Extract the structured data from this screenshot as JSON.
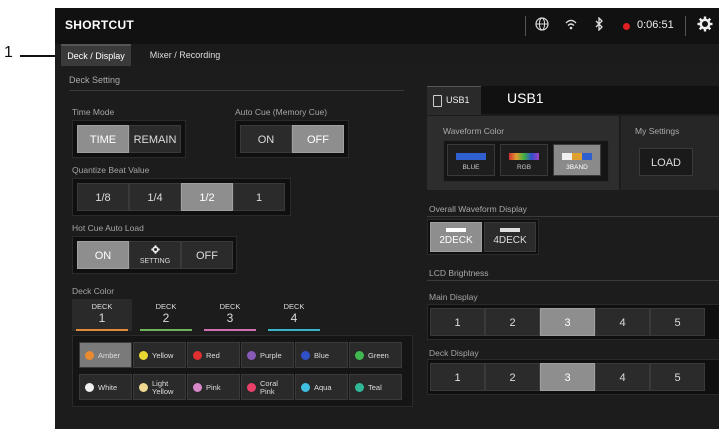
{
  "callout": "1",
  "app": {
    "title": "SHORTCUT",
    "rec_time": "0:06:51"
  },
  "tabs": [
    {
      "label": "Deck / Display"
    },
    {
      "label": "Mixer / Recording"
    }
  ],
  "deck_setting": {
    "title": "Deck Setting",
    "time_mode": {
      "label": "Time Mode",
      "options": [
        "TIME",
        "REMAIN"
      ],
      "selected": "TIME"
    },
    "auto_cue": {
      "label": "Auto Cue (Memory Cue)",
      "options": [
        "ON",
        "OFF"
      ],
      "selected": "OFF"
    },
    "quantize": {
      "label": "Quantize Beat Value",
      "options": [
        "1/8",
        "1/4",
        "1/2",
        "1"
      ],
      "selected": "1/2"
    },
    "hot_cue": {
      "label": "Hot Cue Auto Load",
      "on": "ON",
      "setting": "SETTING",
      "off": "OFF",
      "selected": "ON"
    },
    "deck_color": {
      "label": "Deck Color",
      "decks": [
        {
          "label": "DECK",
          "num": "1",
          "color": "#e08a3c"
        },
        {
          "label": "DECK",
          "num": "2",
          "color": "#6db55a"
        },
        {
          "label": "DECK",
          "num": "3",
          "color": "#d070b0"
        },
        {
          "label": "DECK",
          "num": "4",
          "color": "#3cb4c8"
        }
      ],
      "selected_deck": "1",
      "colors": [
        {
          "label": "Amber",
          "color": "#e88a30"
        },
        {
          "label": "Yellow",
          "color": "#e8d830"
        },
        {
          "label": "Red",
          "color": "#e03030"
        },
        {
          "label": "Purple",
          "color": "#8a5ab8"
        },
        {
          "label": "Blue",
          "color": "#3050c8"
        },
        {
          "label": "Green",
          "color": "#40b850"
        },
        {
          "label": "White",
          "color": "#f0f0f0"
        },
        {
          "label": "Light\nYellow",
          "color": "#f0d890"
        },
        {
          "label": "Pink",
          "color": "#d888c8"
        },
        {
          "label": "Coral\nPink",
          "color": "#e84068"
        },
        {
          "label": "Aqua",
          "color": "#40c0e0"
        },
        {
          "label": "Teal",
          "color": "#30b898"
        }
      ],
      "selected_color": "Amber"
    }
  },
  "usb": {
    "tab_label": "USB1",
    "title": "USB1",
    "waveform_color": {
      "label": "Waveform Color",
      "options": [
        {
          "label": "BLUE",
          "bar": "#3060d0"
        },
        {
          "label": "RGB",
          "bar": "rgb-gradient"
        },
        {
          "label": "3BAND",
          "bar": "3band"
        }
      ],
      "selected": "3BAND"
    },
    "my_settings": {
      "label": "My Settings",
      "button": "LOAD"
    }
  },
  "overall_waveform": {
    "title": "Overall Waveform Display",
    "options": [
      "2DECK",
      "4DECK"
    ],
    "selected": "2DECK"
  },
  "lcd": {
    "title": "LCD Brightness",
    "main": {
      "label": "Main Display",
      "options": [
        "1",
        "2",
        "3",
        "4",
        "5"
      ],
      "selected": "3"
    },
    "deck": {
      "label": "Deck Display",
      "options": [
        "1",
        "2",
        "3",
        "4",
        "5"
      ],
      "selected": "3"
    }
  }
}
